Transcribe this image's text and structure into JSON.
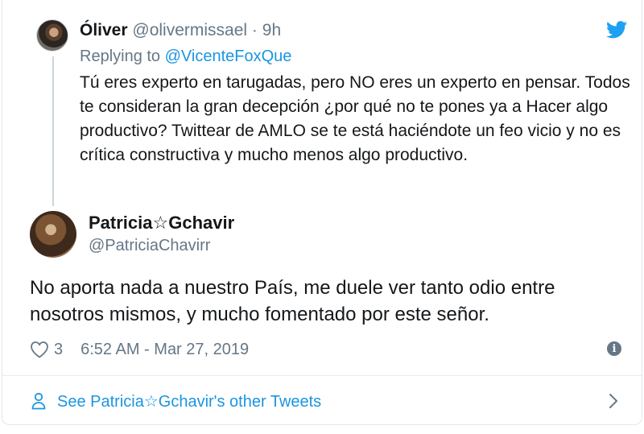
{
  "parent_tweet": {
    "name": "Óliver",
    "handle": "@olivermissael",
    "separator": "·",
    "time": "9h",
    "replying_prefix": "Replying to",
    "replying_to": "@VicenteFoxQue",
    "text": "Tú eres experto en tarugadas, pero NO eres un experto en pensar. Todos te consideran la gran decepción ¿por qué no te pones ya a Hacer algo productivo? Twittear de AMLO se te está haciéndote un feo vicio y no es crítica constructiva y mucho menos algo productivo."
  },
  "tweet": {
    "name": "Patricia☆Gchavir",
    "handle": "@PatriciaChavirr",
    "text": "No aporta nada a nuestro País, me duele ver tanto odio entre nosotros mismos, y mucho fomentado por este señor.",
    "like_count": "3",
    "timestamp": "6:52 AM - Mar 27, 2019"
  },
  "footer": {
    "link_text": "See Patricia☆Gchavir's other Tweets"
  },
  "icons": {
    "brand": "twitter-bird-icon",
    "like": "heart-icon",
    "info": "info-icon",
    "user": "user-icon",
    "chevron": "chevron-right-icon"
  },
  "colors": {
    "accent": "#1b95e0",
    "muted": "#657786",
    "text": "#14171a",
    "border": "#e1e8ed"
  }
}
